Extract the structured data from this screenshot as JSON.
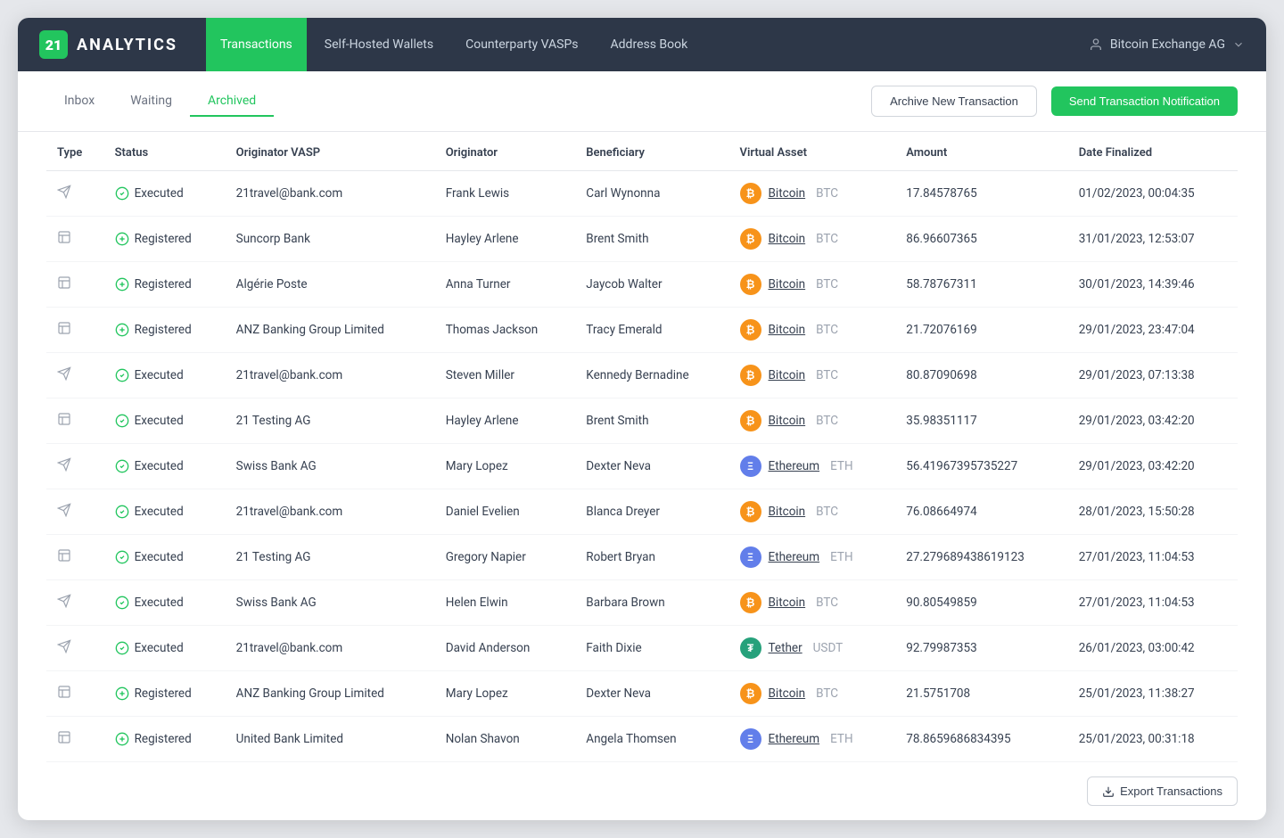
{
  "logo": {
    "box": "21",
    "text": "ANALYTICS"
  },
  "nav": {
    "links": [
      {
        "label": "Transactions",
        "active": true
      },
      {
        "label": "Self-Hosted Wallets",
        "active": false
      },
      {
        "label": "Counterparty VASPs",
        "active": false
      },
      {
        "label": "Address Book",
        "active": false
      }
    ],
    "user": "Bitcoin Exchange AG"
  },
  "tabs": [
    {
      "label": "Inbox",
      "active": false
    },
    {
      "label": "Waiting",
      "active": false
    },
    {
      "label": "Archived",
      "active": true
    }
  ],
  "buttons": {
    "archive": "Archive New Transaction",
    "notify": "Send Transaction Notification",
    "export": "Export Transactions"
  },
  "table": {
    "headers": [
      "Type",
      "Status",
      "Originator VASP",
      "Originator",
      "Beneficiary",
      "Virtual Asset",
      "Amount",
      "Date Finalized"
    ],
    "rows": [
      {
        "type": "outgoing",
        "status": "Executed",
        "status_type": "executed",
        "originator_vasp": "21travel@bank.com",
        "originator": "Frank Lewis",
        "beneficiary": "Carl Wynonna",
        "asset": "Bitcoin",
        "asset_ticker": "BTC",
        "asset_type": "btc",
        "amount": "17.84578765",
        "date": "01/02/2023, 00:04:35"
      },
      {
        "type": "incoming",
        "status": "Registered",
        "status_type": "registered",
        "originator_vasp": "Suncorp Bank",
        "originator": "Hayley Arlene",
        "beneficiary": "Brent Smith",
        "asset": "Bitcoin",
        "asset_ticker": "BTC",
        "asset_type": "btc",
        "amount": "86.96607365",
        "date": "31/01/2023, 12:53:07"
      },
      {
        "type": "incoming",
        "status": "Registered",
        "status_type": "registered",
        "originator_vasp": "Algérie Poste",
        "originator": "Anna Turner",
        "beneficiary": "Jaycob Walter",
        "asset": "Bitcoin",
        "asset_ticker": "BTC",
        "asset_type": "btc",
        "amount": "58.78767311",
        "date": "30/01/2023, 14:39:46"
      },
      {
        "type": "incoming",
        "status": "Registered",
        "status_type": "registered",
        "originator_vasp": "ANZ Banking Group Limited",
        "originator": "Thomas Jackson",
        "beneficiary": "Tracy Emerald",
        "asset": "Bitcoin",
        "asset_ticker": "BTC",
        "asset_type": "btc",
        "amount": "21.72076169",
        "date": "29/01/2023, 23:47:04"
      },
      {
        "type": "outgoing",
        "status": "Executed",
        "status_type": "executed",
        "originator_vasp": "21travel@bank.com",
        "originator": "Steven Miller",
        "beneficiary": "Kennedy Bernadine",
        "asset": "Bitcoin",
        "asset_ticker": "BTC",
        "asset_type": "btc",
        "amount": "80.87090698",
        "date": "29/01/2023, 07:13:38"
      },
      {
        "type": "incoming",
        "status": "Executed",
        "status_type": "executed",
        "originator_vasp": "21 Testing AG",
        "originator": "Hayley Arlene",
        "beneficiary": "Brent Smith",
        "asset": "Bitcoin",
        "asset_ticker": "BTC",
        "asset_type": "btc",
        "amount": "35.98351117",
        "date": "29/01/2023, 03:42:20"
      },
      {
        "type": "outgoing",
        "status": "Executed",
        "status_type": "executed",
        "originator_vasp": "Swiss Bank AG",
        "originator": "Mary Lopez",
        "beneficiary": "Dexter Neva",
        "asset": "Ethereum",
        "asset_ticker": "ETH",
        "asset_type": "eth",
        "amount": "56.41967395735227",
        "date": "29/01/2023, 03:42:20"
      },
      {
        "type": "outgoing",
        "status": "Executed",
        "status_type": "executed",
        "originator_vasp": "21travel@bank.com",
        "originator": "Daniel Evelien",
        "beneficiary": "Blanca Dreyer",
        "asset": "Bitcoin",
        "asset_ticker": "BTC",
        "asset_type": "btc",
        "amount": "76.08664974",
        "date": "28/01/2023, 15:50:28"
      },
      {
        "type": "incoming",
        "status": "Executed",
        "status_type": "executed",
        "originator_vasp": "21 Testing AG",
        "originator": "Gregory Napier",
        "beneficiary": "Robert Bryan",
        "asset": "Ethereum",
        "asset_ticker": "ETH",
        "asset_type": "eth",
        "amount": "27.279689438619123",
        "date": "27/01/2023, 11:04:53"
      },
      {
        "type": "outgoing",
        "status": "Executed",
        "status_type": "executed",
        "originator_vasp": "Swiss Bank AG",
        "originator": "Helen Elwin",
        "beneficiary": "Barbara Brown",
        "asset": "Bitcoin",
        "asset_ticker": "BTC",
        "asset_type": "btc",
        "amount": "90.80549859",
        "date": "27/01/2023, 11:04:53"
      },
      {
        "type": "outgoing",
        "status": "Executed",
        "status_type": "executed",
        "originator_vasp": "21travel@bank.com",
        "originator": "David Anderson",
        "beneficiary": "Faith Dixie",
        "asset": "Tether",
        "asset_ticker": "USDT",
        "asset_type": "usdt",
        "amount": "92.79987353",
        "date": "26/01/2023, 03:00:42"
      },
      {
        "type": "incoming",
        "status": "Registered",
        "status_type": "registered",
        "originator_vasp": "ANZ Banking Group Limited",
        "originator": "Mary Lopez",
        "beneficiary": "Dexter Neva",
        "asset": "Bitcoin",
        "asset_ticker": "BTC",
        "asset_type": "btc",
        "amount": "21.5751708",
        "date": "25/01/2023, 11:38:27"
      },
      {
        "type": "incoming",
        "status": "Registered",
        "status_type": "registered",
        "originator_vasp": "United Bank Limited",
        "originator": "Nolan Shavon",
        "beneficiary": "Angela Thomsen",
        "asset": "Ethereum",
        "asset_ticker": "ETH",
        "asset_type": "eth",
        "amount": "78.8659686834395",
        "date": "25/01/2023, 00:31:18"
      }
    ]
  }
}
